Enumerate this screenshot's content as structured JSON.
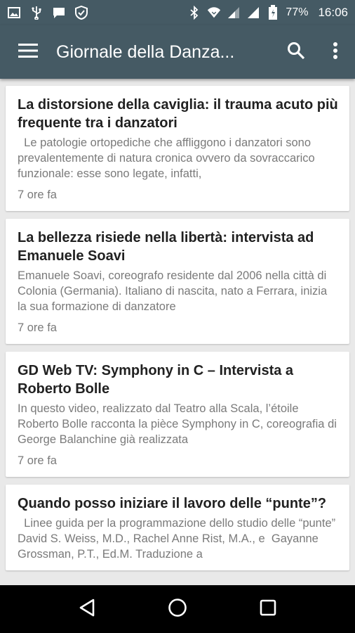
{
  "status_bar": {
    "battery": "77%",
    "time": "16:06",
    "icons": [
      "image-icon",
      "usb-icon",
      "message-icon",
      "shield-icon",
      "bluetooth-icon",
      "wifi-icon",
      "signal-icon",
      "signal-icon",
      "battery-icon"
    ]
  },
  "app_bar": {
    "title": "Giornale della Danza...",
    "icons": [
      "menu-icon",
      "search-icon",
      "more-vert-icon"
    ]
  },
  "articles": [
    {
      "title": "La distorsione della caviglia: il trauma acuto più frequente tra i danzatori",
      "snippet": "  Le patologie ortopediche che affliggono i danzatori sono prevalentemente di natura cronica ovvero da sovraccarico funzionale: esse sono legate, infatti,",
      "time": "7 ore fa"
    },
    {
      "title": "La bellezza risiede nella libertà: intervista ad Emanuele Soavi",
      "snippet": "Emanuele Soavi, coreografo residente dal 2006 nella città di Colonia (Germania). Italiano di nascita, nato a Ferrara, inizia la sua formazione di danzatore",
      "time": "7 ore fa"
    },
    {
      "title": "GD Web TV: Symphony in C – Intervista a Roberto Bolle",
      "snippet": "In questo video, realizzato dal Teatro alla Scala, l’étoile Roberto Bolle racconta la pièce Symphony in C, coreografia di George Balanchine già realizzata",
      "time": "7 ore fa"
    },
    {
      "title": "Quando posso iniziare il lavoro delle “punte”?",
      "snippet": "  Linee guida per la programmazione dello studio delle “punte” David S. Weiss, M.D., Rachel Anne Rist, M.A., e  Gayanne Grossman, P.T., Ed.M. Traduzione a",
      "time": ""
    }
  ],
  "nav_bar": {
    "icons": [
      "back-icon",
      "home-icon",
      "recents-icon"
    ]
  },
  "colors": {
    "app_bar": "#455a64",
    "background": "#e9e9e9",
    "card": "#ffffff",
    "title_text": "#212121",
    "secondary_text": "#7a7a7a"
  }
}
